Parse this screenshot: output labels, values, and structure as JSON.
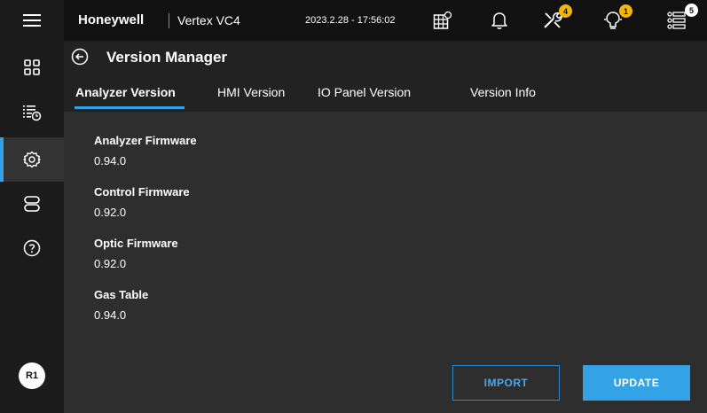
{
  "topbar": {
    "brand": "Honeywell",
    "product": "Vertex VC4",
    "datetime": "2023.2.28 - 17:56:02",
    "icons": [
      "calendar-settings-icon",
      "bell-icon",
      "tools-icon",
      "maintenance-icon",
      "list-icon"
    ],
    "badges": {
      "tools": "4",
      "maintenance": "1",
      "list": "5"
    },
    "badge_color": "#f2b705"
  },
  "sidebar": {
    "items": [
      "menu-icon",
      "dashboard-icon",
      "event-log-icon",
      "settings-icon",
      "storage-icon",
      "help-icon"
    ],
    "active": "settings-icon",
    "avatar": "R1",
    "accent": "#33a3e6"
  },
  "header": {
    "title": "Version Manager",
    "tabs": [
      {
        "label": "Analyzer Version",
        "active": true
      },
      {
        "label": "HMI Version",
        "active": false
      },
      {
        "label": "IO Panel Version",
        "active": false
      },
      {
        "label": "Version Info",
        "active": false
      }
    ]
  },
  "versions": [
    {
      "label": "Analyzer Firmware",
      "value": "0.94.0"
    },
    {
      "label": "Control Firmware",
      "value": "0.92.0"
    },
    {
      "label": "Optic Firmware",
      "value": "0.92.0"
    },
    {
      "label": "Gas Table",
      "value": "0.94.0"
    }
  ],
  "actions": {
    "import_label": "IMPORT",
    "update_label": "UPDATE"
  }
}
